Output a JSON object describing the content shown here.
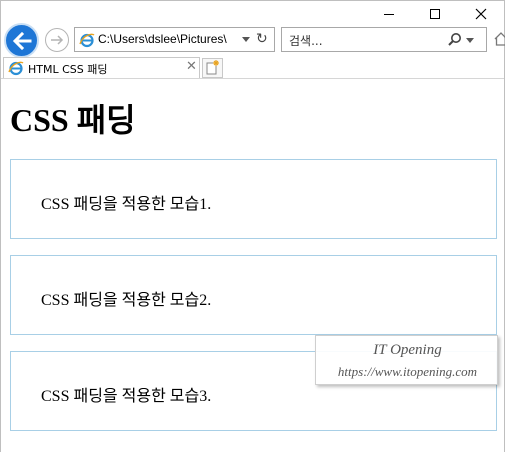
{
  "window": {
    "tab_title": "HTML CSS 패딩",
    "address": "C:\\Users\\dslee\\Pictures\\",
    "search_placeholder": "검색..."
  },
  "page": {
    "heading": "CSS 패딩",
    "boxes": [
      "CSS 패딩을 적용한 모습1.",
      "CSS 패딩을 적용한 모습2.",
      "CSS 패딩을 적용한 모습3."
    ]
  },
  "watermark": {
    "title": "IT Opening",
    "url": "https://www.itopening.com"
  },
  "icons": [
    "minimize-icon",
    "maximize-icon",
    "close-icon",
    "back-arrow-icon",
    "forward-arrow-icon",
    "ie-icon",
    "dropdown-icon",
    "refresh-icon",
    "search-icon",
    "home-icon",
    "tab-close-icon",
    "new-tab-icon"
  ],
  "colors": {
    "back_button": "#1e76d6",
    "box_border": "#a8cfe6"
  }
}
